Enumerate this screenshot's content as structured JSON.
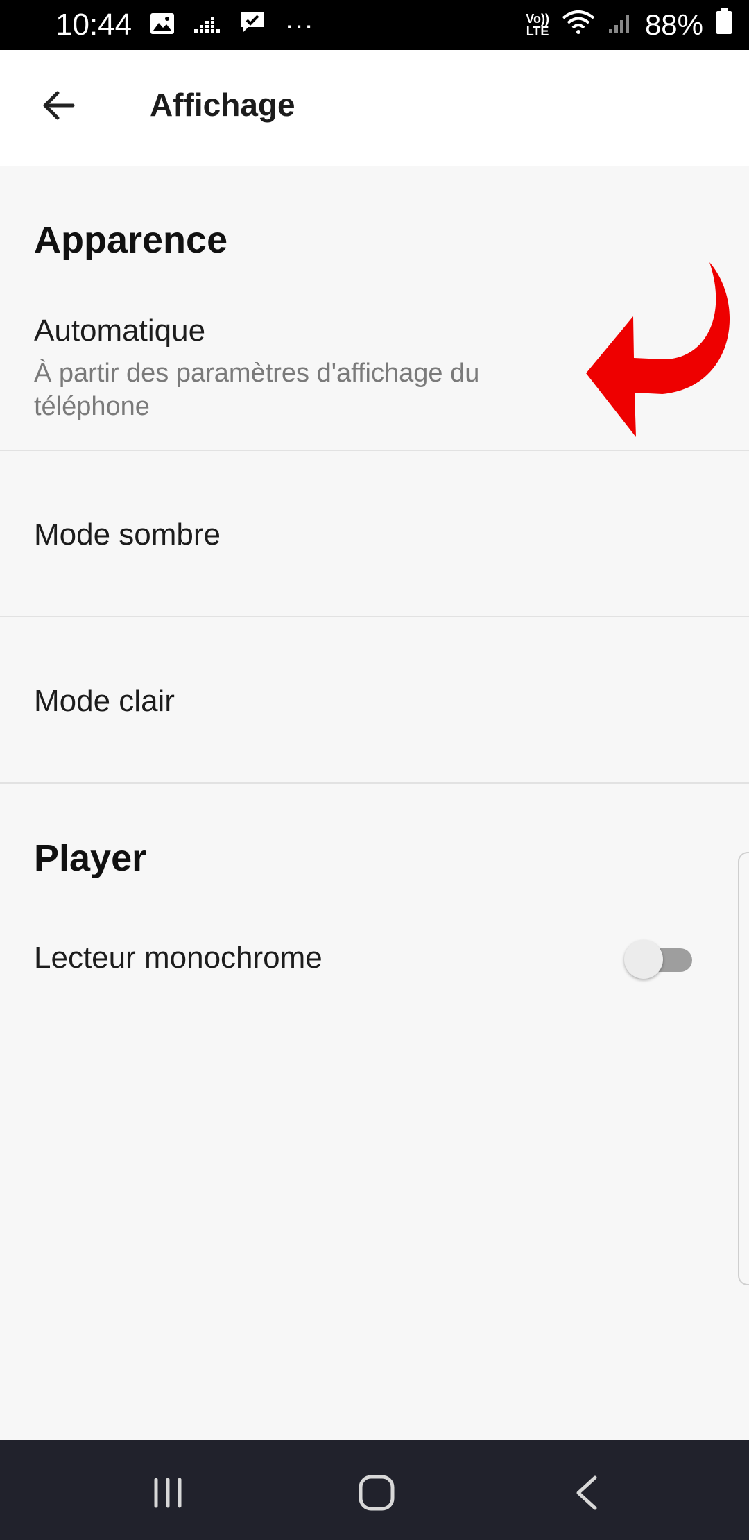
{
  "status_bar": {
    "time": "10:44",
    "more": "···",
    "lte_top": "Vo))",
    "lte_bottom": "LTE",
    "battery": "88%"
  },
  "app_bar": {
    "title": "Affichage"
  },
  "appearance": {
    "section_title": "Apparence",
    "options": [
      {
        "label": "Automatique",
        "description": "À partir des paramètres d'affichage du téléphone"
      },
      {
        "label": "Mode sombre"
      },
      {
        "label": "Mode clair"
      }
    ]
  },
  "player": {
    "section_title": "Player",
    "monochrome_label": "Lecteur monochrome",
    "monochrome_enabled": false
  },
  "colors": {
    "background": "#f7f7f7",
    "app_bar": "#ffffff",
    "annotation_arrow": "#ee0000",
    "nav_bar": "#21222c"
  }
}
